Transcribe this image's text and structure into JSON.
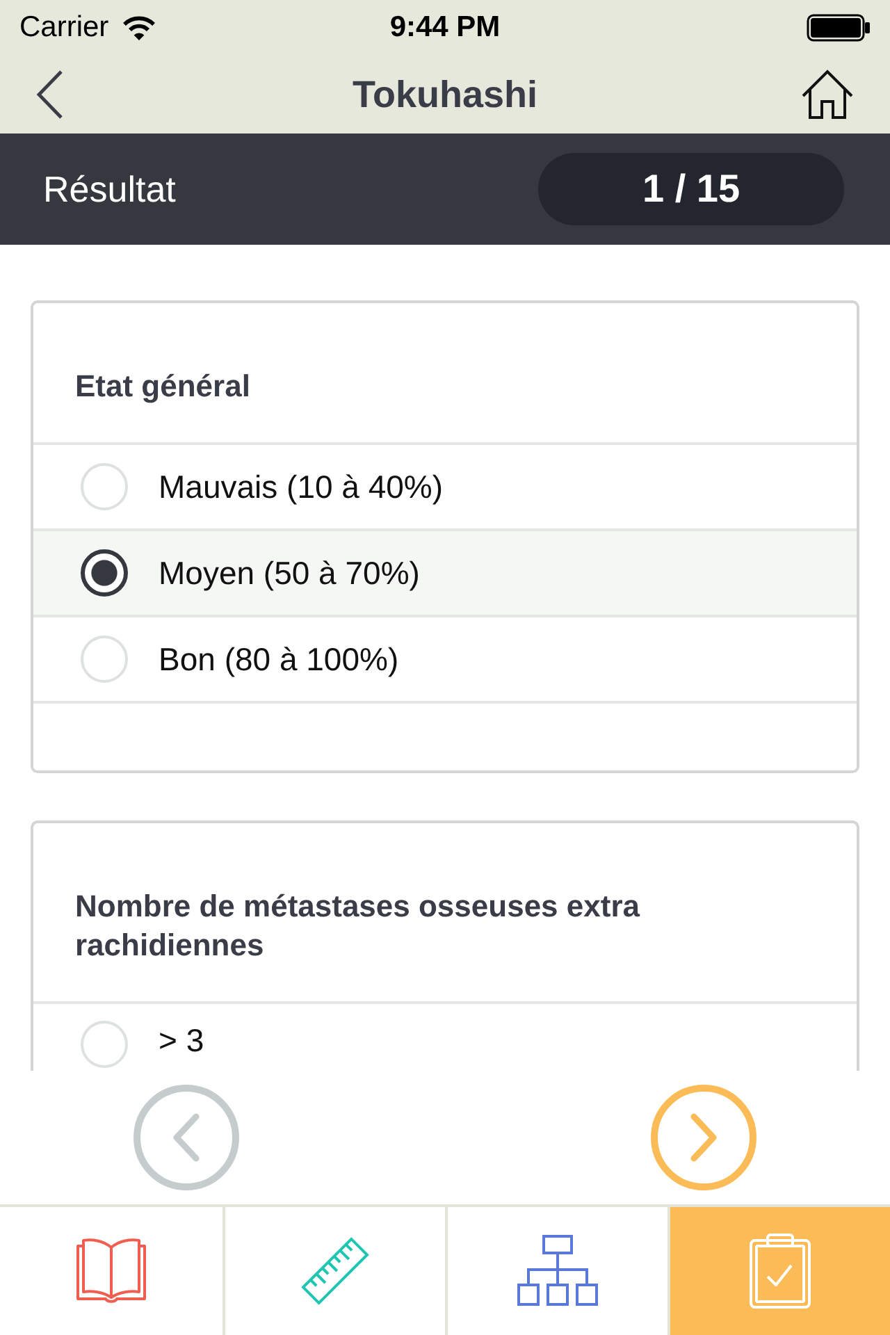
{
  "status_bar": {
    "carrier": "Carrier",
    "time": "9:44 PM"
  },
  "nav_bar": {
    "title": "Tokuhashi"
  },
  "section_header": {
    "label": "Résultat",
    "progress": "1 / 15"
  },
  "questions": [
    {
      "title": "Etat général",
      "options": [
        {
          "label": "Mauvais (10 à 40%)",
          "selected": false
        },
        {
          "label": "Moyen (50 à 70%)",
          "selected": true
        },
        {
          "label": "Bon (80 à 100%)",
          "selected": false
        }
      ]
    },
    {
      "title": "Nombre de métastases osseuses extra rachidiennes",
      "options": [
        {
          "label": "> 3",
          "selected": false
        }
      ]
    }
  ],
  "pager": {
    "previous": {
      "disabled": true
    },
    "next": {
      "disabled": false
    }
  },
  "tab_bar": {
    "tabs": [
      {
        "kind": "book",
        "color": "#ef5f50",
        "selected": false
      },
      {
        "kind": "ruler",
        "color": "#1ec6b1",
        "selected": false
      },
      {
        "kind": "hierarchy",
        "color": "#5a78d8",
        "selected": false
      },
      {
        "kind": "clipboard",
        "color": "#fbbc57",
        "selected": true
      }
    ]
  }
}
